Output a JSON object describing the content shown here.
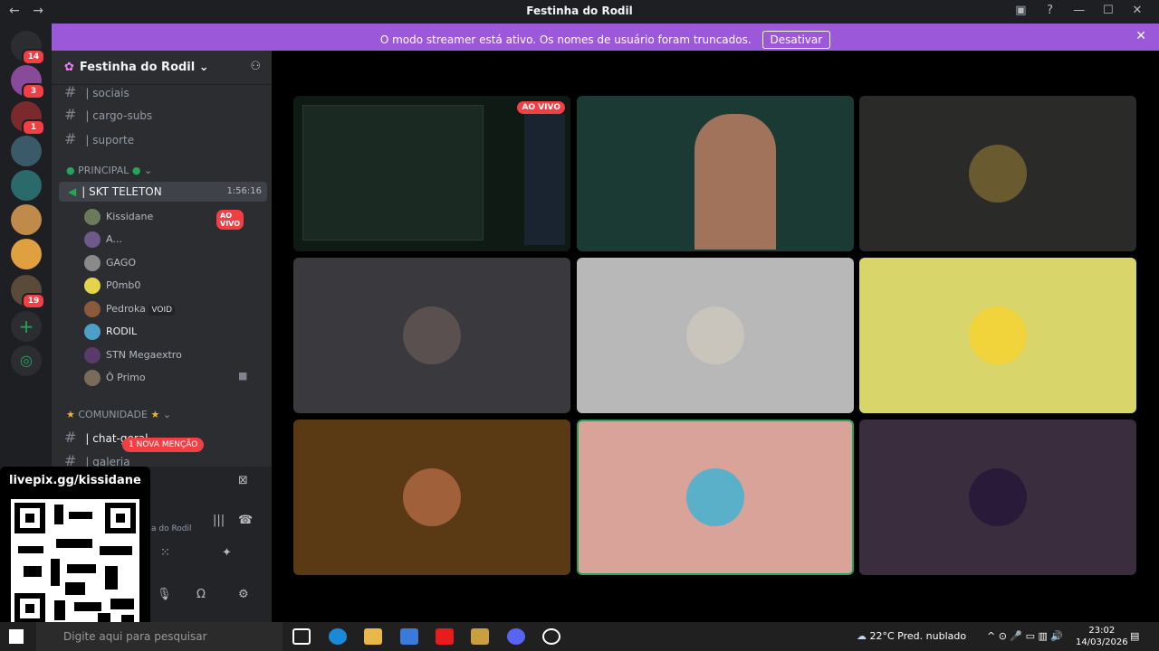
{
  "window": {
    "title": "Festinha do Rodil",
    "back_icon": "←",
    "forward_icon": "→"
  },
  "banner": {
    "message": "O modo streamer está ativo. Os nomes de usuário foram truncados.",
    "button": "Desativar",
    "close": "✕"
  },
  "guilds": {
    "badges": [
      "14",
      "3",
      "1",
      "19"
    ]
  },
  "server": {
    "name": "Festinha do Rodil ⌄"
  },
  "channels": [
    {
      "label": "| sociais"
    },
    {
      "label": "| cargo-subs"
    },
    {
      "label": "| suporte"
    }
  ],
  "categories": {
    "principal": "PRINCIPAL",
    "comunidade": "COMUNIDADE"
  },
  "voice": {
    "label": "| SKT TELETON",
    "time": "1:56:16"
  },
  "members": [
    {
      "name": "Kissidane",
      "live": "AO VIVO",
      "color": "#6b7a5a"
    },
    {
      "name": "A...",
      "color": "#6e5a8a"
    },
    {
      "name": "GAGO",
      "color": "#8a8a8a"
    },
    {
      "name": "P0mb0",
      "color": "#e4d44a"
    },
    {
      "name": "Pedroka",
      "tag": "VOID",
      "color": "#8a5a3a"
    },
    {
      "name": "RODIL",
      "color": "#4aa0c8"
    },
    {
      "name": "STN Megaextro",
      "color": "#5a3a6a"
    },
    {
      "name": "Ô Primo",
      "color": "#7a6a5a"
    }
  ],
  "community_channels": [
    {
      "label": "| chat-geral"
    },
    {
      "label": "| galeria"
    }
  ],
  "mention": "1 NOVA MENÇÃO",
  "panel": {
    "sub": "a do Rodil"
  },
  "overlay": {
    "text": "livepix.gg/kissidane"
  },
  "stage": {
    "live": "AO VIVO"
  },
  "tiles": [
    {
      "bg": "#0f1a14"
    },
    {
      "bg": "#1a3a33"
    },
    {
      "bg": "#2a2a28"
    },
    {
      "bg": "#3a393d",
      "av": "#5a5050"
    },
    {
      "bg": "#b8b8b8",
      "av": "#c9c4bc"
    },
    {
      "bg": "#d8d66a",
      "av": "#f1d33b"
    },
    {
      "bg": "#5a3a14",
      "av": "#a0603a"
    },
    {
      "bg": "#d9a39a",
      "av": "#5ab0c8"
    },
    {
      "bg": "#3a2d3d",
      "av": "#2a1a3a"
    }
  ],
  "taskbar": {
    "search": "Digite aqui para pesquisar",
    "weather": "22°C  Pred. nublado",
    "time": "23:02",
    "date": "14/03/2026"
  }
}
